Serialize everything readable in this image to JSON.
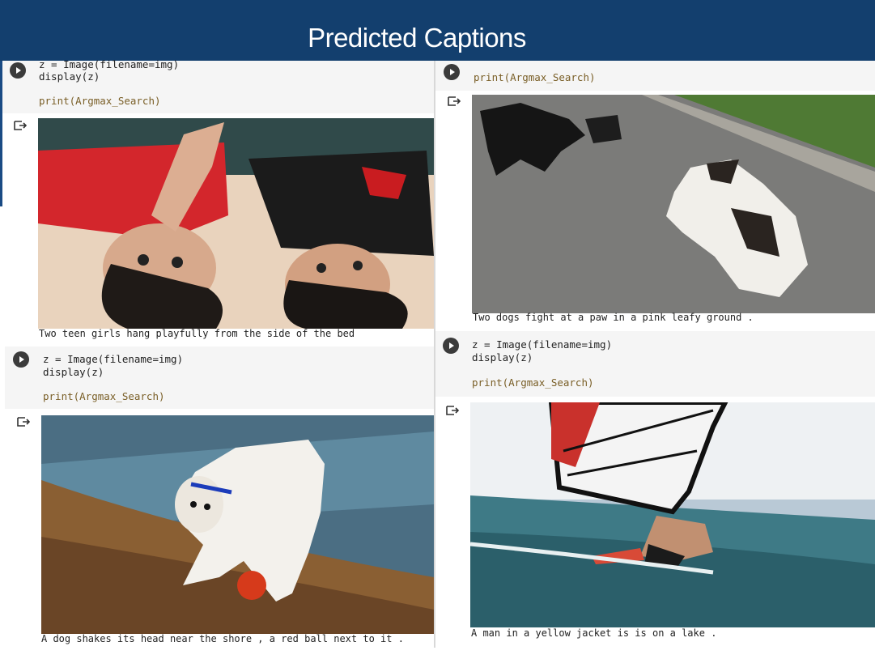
{
  "slide": {
    "title": "Predicted Captions"
  },
  "cells": [
    {
      "code": [
        "z = Image(filename=img)",
        "display(z)",
        "",
        "print(Argmax_Search)"
      ],
      "caption": "Two teen girls hang playfully from the side of the bed"
    },
    {
      "code": [
        "print(Argmax_Search)"
      ],
      "caption": "Two dogs fight at a paw in a pink leafy ground ."
    },
    {
      "code": [
        "z = Image(filename=img)",
        "display(z)",
        "",
        "print(Argmax_Search)"
      ],
      "caption": "A dog shakes its head near the shore , a red ball next to it ."
    },
    {
      "code": [
        "z = Image(filename=img)",
        "display(z)",
        "",
        "print(Argmax_Search)"
      ],
      "caption": "A man in a yellow jacket is is on a lake ."
    }
  ],
  "icons": {
    "run": "play-circle-icon",
    "output": "output-arrow-icon"
  },
  "colors": {
    "title_bar": "#133f6e",
    "code_bg": "#f5f5f5",
    "print_keyword": "#795e26"
  }
}
